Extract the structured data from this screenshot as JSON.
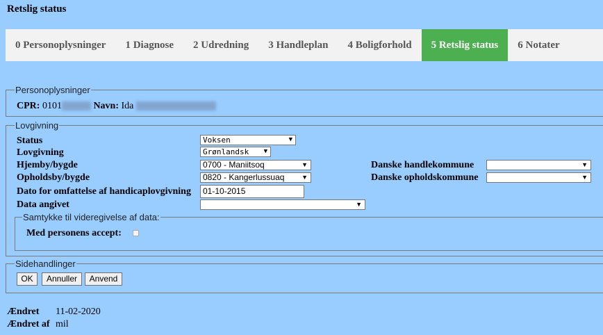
{
  "page": {
    "title": "Retslig status"
  },
  "tabs": [
    {
      "label": "0 Personoplysninger",
      "active": false
    },
    {
      "label": "1 Diagnose",
      "active": false
    },
    {
      "label": "2 Udredning",
      "active": false
    },
    {
      "label": "3 Handleplan",
      "active": false
    },
    {
      "label": "4 Boligforhold",
      "active": false
    },
    {
      "label": "5 Retslig status",
      "active": true
    },
    {
      "label": "6 Notater",
      "active": false
    }
  ],
  "personoplysninger": {
    "legend": "Personoplysninger",
    "cpr_label": "CPR:",
    "cpr_value": "0101",
    "navn_label": "Navn:",
    "navn_value": "Ida"
  },
  "lovgivning": {
    "legend": "Lovgivning",
    "status": {
      "label": "Status",
      "value": "Voksen"
    },
    "lovgivning": {
      "label": "Lovgivning",
      "value": "Grønlandsk"
    },
    "hjemby": {
      "label": "Hjemby/bygde",
      "value": "0700 - Maniitsoq"
    },
    "opholdsby": {
      "label": "Opholdsby/bygde",
      "value": "0820 - Kangerlussuaq"
    },
    "dato": {
      "label": "Dato for omfattelse af handicaplovgivning",
      "value": "01-10-2015"
    },
    "data_angivet": {
      "label": "Data angivet",
      "value": ""
    },
    "handlekommune": {
      "label": "Danske handlekommune",
      "value": ""
    },
    "opholdskommune": {
      "label": "Danske opholdskommune",
      "value": ""
    },
    "samtykke": {
      "legend": "Samtykke til videregivelse af data:",
      "accept_label": "Med personens accept:",
      "checked": false
    }
  },
  "sidehandlinger": {
    "legend": "Sidehandlinger",
    "ok": "OK",
    "annuller": "Annuller",
    "anvend": "Anvend"
  },
  "footer": {
    "aendret_label": "Ændret",
    "aendret_value": "11-02-2020",
    "aendret_af_label": "Ændret af",
    "aendret_af_value": "mil"
  },
  "icons": {
    "dropdown": "chevron-down-icon",
    "checkbox": "checkbox-icon"
  },
  "colors": {
    "background": "#99ccff",
    "tab_active": "#4caf50",
    "tabbar": "#f2f2f2"
  }
}
